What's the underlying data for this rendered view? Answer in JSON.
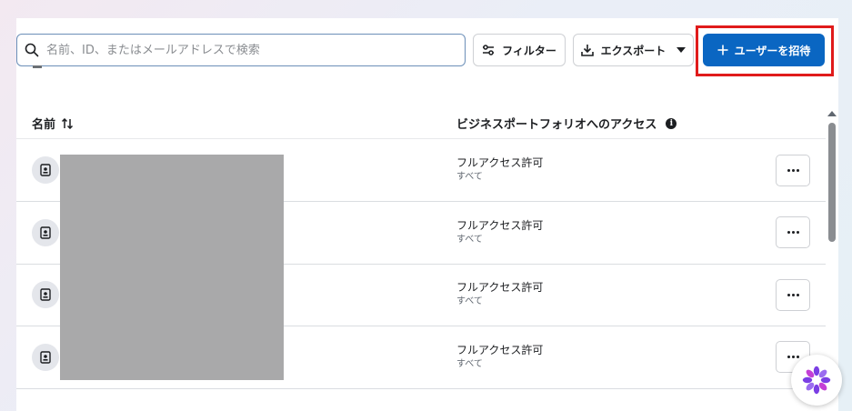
{
  "toolbar": {
    "search_placeholder": "名前、ID、またはメールアドレスで検索",
    "filter_label": "フィルター",
    "export_label": "エクスポート",
    "invite_label": "ユーザーを招待",
    "invite_color": "#0a66c2",
    "highlight_color": "#e01b1b"
  },
  "table": {
    "columns": [
      "名前",
      "ビジネスポートフォリオへのアクセス"
    ],
    "rows": [
      {
        "access": "フルアクセス許可",
        "scope": "すべて"
      },
      {
        "access": "フルアクセス許可",
        "scope": "すべて"
      },
      {
        "access": "フルアクセス許可",
        "scope": "すべて"
      },
      {
        "access": "フルアクセス許可",
        "scope": "すべて"
      }
    ]
  }
}
